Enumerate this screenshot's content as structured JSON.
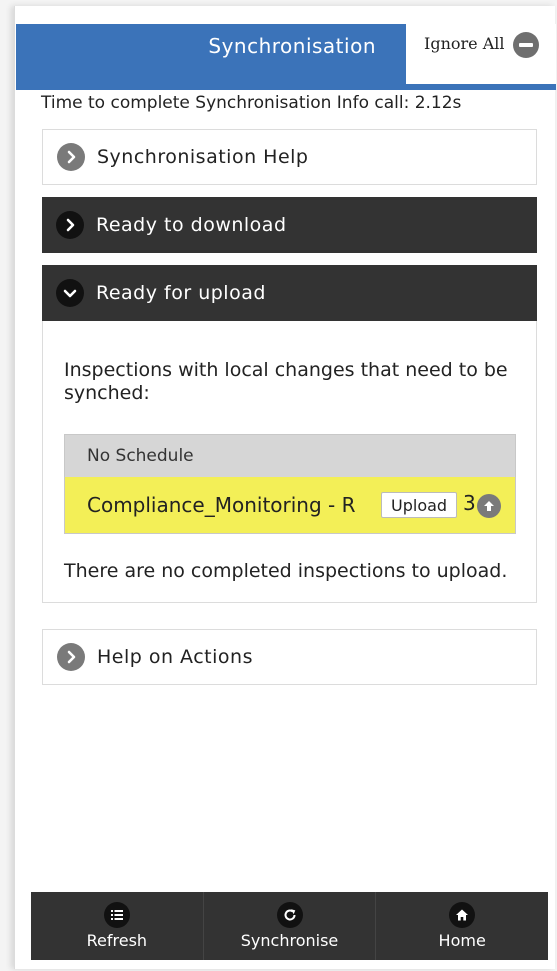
{
  "header": {
    "title": "Synchronisation",
    "ignore_all_label": "Ignore All",
    "accent_color": "#3b73b9"
  },
  "timing_text": "Time to complete Synchronisation Info call: 2.12s",
  "sections": {
    "sync_help": {
      "label": "Synchronisation Help",
      "icon": "chevron-right-icon"
    },
    "ready_download": {
      "label": "Ready to download",
      "icon": "chevron-right-icon",
      "expanded": false
    },
    "ready_upload": {
      "label": "Ready for upload",
      "icon": "chevron-down-icon",
      "expanded": true,
      "description": "Inspections with local changes that need to be synched:",
      "schedule_header": "No Schedule",
      "item_label": "Compliance_Monitoring - R",
      "item_tail": "3",
      "upload_label": "Upload",
      "footer": "There are no completed inspections to upload."
    },
    "help_actions": {
      "label": "Help on Actions",
      "icon": "chevron-right-icon"
    }
  },
  "bottom_nav": {
    "refresh": {
      "label": "Refresh",
      "icon": "list-icon"
    },
    "synchronise": {
      "label": "Synchronise",
      "icon": "refresh-icon"
    },
    "home": {
      "label": "Home",
      "icon": "home-icon"
    }
  },
  "colors": {
    "dark_bar": "#333333",
    "highlight_row": "#f3ef57",
    "schedule_header": "#d6d6d6"
  }
}
